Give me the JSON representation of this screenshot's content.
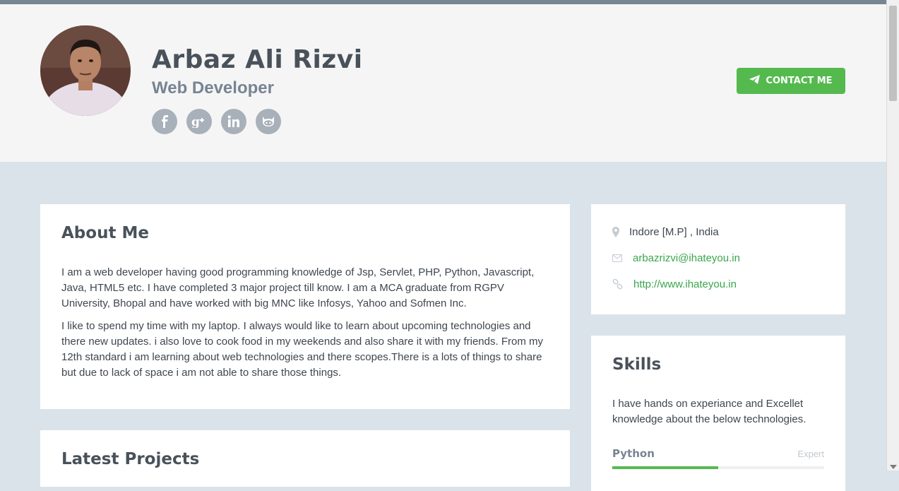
{
  "header": {
    "name": "Arbaz Ali Rizvi",
    "role": "Web Developer",
    "contact_label": "CONTACT ME",
    "socials": [
      {
        "icon": "facebook-icon",
        "glyph": "f"
      },
      {
        "icon": "google-plus-icon",
        "glyph": "g+"
      },
      {
        "icon": "linkedin-icon",
        "glyph": "in"
      },
      {
        "icon": "github-icon",
        "glyph": "github"
      }
    ]
  },
  "about": {
    "title": "About Me",
    "paragraphs": [
      "I am a web developer having good programming knowledge of Jsp, Servlet, PHP, Python, Javascript, Java, HTML5 etc. I have completed 3 major project till know. I am a MCA graduate from RGPV University, Bhopal and have worked with big MNC like Infosys, Yahoo and Sofmen Inc.",
      "I like to spend my time with my laptop. I always would like to learn about upcoming technologies and there new updates. i also love to cook food in my weekends and also share it with my friends. From my 12th standard i am learning about web technologies and there scopes.There is a lots of things to share but due to lack of space i am not able to share those things."
    ]
  },
  "projects": {
    "title": "Latest Projects"
  },
  "info": {
    "location": "Indore [M.P] , India",
    "email": "arbazrizvi@ihateyou.in",
    "website": "http://www.ihateyou.in"
  },
  "skills": {
    "title": "Skills",
    "intro": "I have hands on experiance and Excellet knowledge about the below technologies.",
    "items": [
      {
        "name": "Python",
        "level": "Expert",
        "progress": 0.5
      }
    ]
  },
  "colors": {
    "accent": "#54ba4e",
    "header_bg": "#f5f5f5",
    "page_bg": "#dae3e9",
    "title": "#49515a",
    "link": "#3aa64c"
  }
}
